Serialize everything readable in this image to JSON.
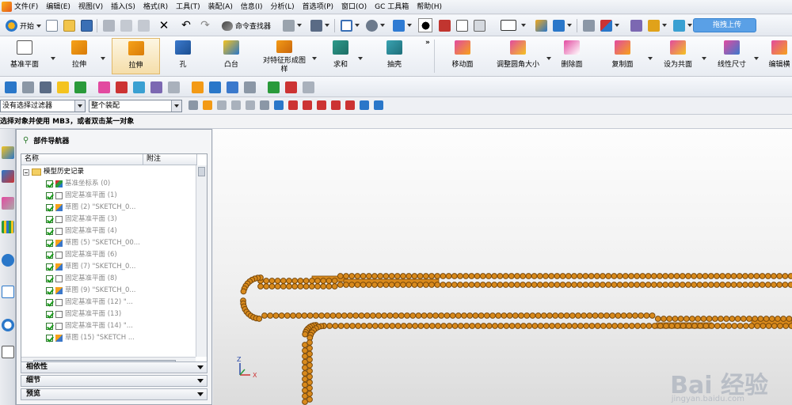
{
  "menubar": {
    "items": [
      "文件(F)",
      "编辑(E)",
      "视图(V)",
      "插入(S)",
      "格式(R)",
      "工具(T)",
      "装配(A)",
      "信息(I)",
      "分析(L)",
      "首选项(P)",
      "窗口(O)",
      "GC 工具箱",
      "帮助(H)"
    ]
  },
  "toolbar": {
    "start_label": "开始",
    "command_finder_label": "命令查找器",
    "upload_label": "拖拽上传"
  },
  "ribbon": {
    "buttons": [
      {
        "label": "基准平面"
      },
      {
        "label": "拉伸"
      },
      {
        "label": "拉伸"
      },
      {
        "label": "孔"
      },
      {
        "label": "凸台"
      },
      {
        "label": "对特征形成图样"
      },
      {
        "label": "求和"
      },
      {
        "label": "抽壳"
      },
      {
        "label": "移动面"
      },
      {
        "label": "调整圆角大小"
      },
      {
        "label": "删除面"
      },
      {
        "label": "复制面"
      },
      {
        "label": "设为共面"
      },
      {
        "label": "线性尺寸"
      },
      {
        "label": "编辑横"
      }
    ]
  },
  "filterbar": {
    "filter_value": "没有选择过滤器",
    "scope_value": "整个装配"
  },
  "status": {
    "prompt": "选择对象并使用 MB3，或者双击某一对象"
  },
  "navigator": {
    "title": "部件导航器",
    "col_name": "名称",
    "col_note": "附注",
    "rows": [
      {
        "label": "模型历史记录",
        "kind": "root"
      },
      {
        "label": "基准坐标系 (0)",
        "kind": "csys"
      },
      {
        "label": "固定基准平面 (1)",
        "kind": "plane"
      },
      {
        "label": "草图 (2) \"SKETCH_0...",
        "kind": "sketch"
      },
      {
        "label": "固定基准平面 (3)",
        "kind": "plane"
      },
      {
        "label": "固定基准平面 (4)",
        "kind": "plane"
      },
      {
        "label": "草图 (5) \"SKETCH_00...",
        "kind": "sketch"
      },
      {
        "label": "固定基准平面 (6)",
        "kind": "plane"
      },
      {
        "label": "草图 (7) \"SKETCH_0...",
        "kind": "sketch"
      },
      {
        "label": "固定基准平面 (8)",
        "kind": "plane"
      },
      {
        "label": "草图 (9) \"SKETCH_0...",
        "kind": "sketch"
      },
      {
        "label": "固定基准平面 (12) \"...",
        "kind": "plane"
      },
      {
        "label": "固定基准平面 (13)",
        "kind": "plane"
      },
      {
        "label": "固定基准平面 (14) \"...",
        "kind": "plane"
      },
      {
        "label": "草图 (15) \"SKETCH ...",
        "kind": "sketch"
      }
    ],
    "sections": [
      "相依性",
      "细节",
      "预览"
    ]
  },
  "viewport": {
    "axis_x": "X",
    "axis_z": "Z",
    "watermark": "Bai 经验",
    "watermark_url": "jingyan.baidu.com"
  },
  "colors": {
    "chain": "#d98a1c",
    "chain_dark": "#7a4a0c",
    "accent_blue": "#5aa0e6"
  }
}
